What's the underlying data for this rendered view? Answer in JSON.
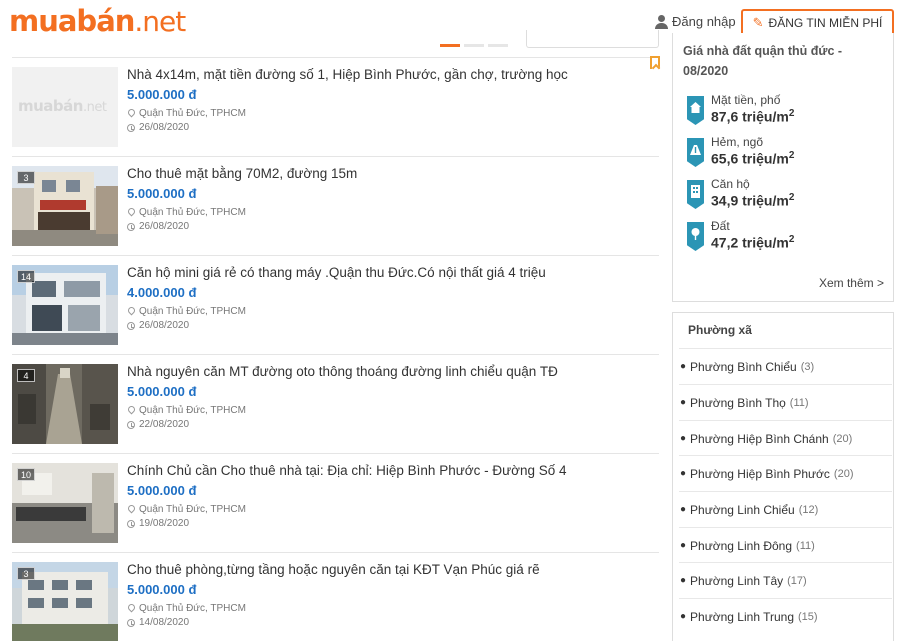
{
  "header": {
    "logo_main": "muabán",
    "logo_tld": ".net",
    "login_label": "Đăng nhập",
    "post_button_label": "ĐĂNG TIN MIỄN PHÍ"
  },
  "listings": [
    {
      "title": "Nhà 4x14m, mặt tiền đường số 1, Hiệp Bình Phước, gần chợ, trường học",
      "price": "5.000.000 đ",
      "location": "Quận Thủ Đức, TPHCM",
      "date": "26/08/2020",
      "photo_count": "",
      "placeholder_main": "muabán",
      "placeholder_tld": ".net"
    },
    {
      "title": "Cho thuê mặt bằng 70M2, đường 15m",
      "price": "5.000.000 đ",
      "location": "Quận Thủ Đức, TPHCM",
      "date": "26/08/2020",
      "photo_count": "3"
    },
    {
      "title": "Căn hộ mini giá rẻ có thang máy .Quận thu Đức.Có nội thất giá 4 triệu",
      "price": "4.000.000 đ",
      "location": "Quận Thủ Đức, TPHCM",
      "date": "26/08/2020",
      "photo_count": "14"
    },
    {
      "title": "Nhà nguyên căn MT đường oto thông thoáng đường linh chiểu quận TĐ",
      "price": "5.000.000 đ",
      "location": "Quận Thủ Đức, TPHCM",
      "date": "22/08/2020",
      "photo_count": "4"
    },
    {
      "title": "Chính Chủ cần Cho thuê nhà tại: Địa chỉ: Hiệp Bình Phước - Đường Số 4",
      "price": "5.000.000 đ",
      "location": "Quận Thủ Đức, TPHCM",
      "date": "19/08/2020",
      "photo_count": "10"
    },
    {
      "title": "Cho thuê phòng,từng tầng hoặc nguyên căn tại KĐT Vạn Phúc giá rẽ",
      "price": "5.000.000 đ",
      "location": "Quận Thủ Đức, TPHCM",
      "date": "14/08/2020",
      "photo_count": "3"
    }
  ],
  "price_panel": {
    "title": "Giá nhà đất quận thủ đức - 08/2020",
    "rows": [
      {
        "label": "Mặt tiền, phố",
        "value": "87,6 triệu/m",
        "sup": "2",
        "icon": "house-icon"
      },
      {
        "label": "Hẻm, ngõ",
        "value": "65,6 triệu/m",
        "sup": "2",
        "icon": "alley-icon"
      },
      {
        "label": "Căn hộ",
        "value": "34,9 triệu/m",
        "sup": "2",
        "icon": "apartment-icon"
      },
      {
        "label": "Đất",
        "value": "47,2 triệu/m",
        "sup": "2",
        "icon": "land-icon"
      }
    ],
    "more_label": "Xem thêm >"
  },
  "ward_panel": {
    "title": "Phường xã",
    "items": [
      {
        "name": "Phường Bình Chiểu",
        "count": "(3)"
      },
      {
        "name": "Phường Bình Thọ",
        "count": "(11)"
      },
      {
        "name": "Phường Hiệp Bình Chánh",
        "count": "(20)"
      },
      {
        "name": "Phường Hiệp Bình Phước",
        "count": "(20)"
      },
      {
        "name": "Phường Linh Chiểu",
        "count": "(12)"
      },
      {
        "name": "Phường Linh Đông",
        "count": "(11)"
      },
      {
        "name": "Phường Linh Tây",
        "count": "(17)"
      },
      {
        "name": "Phường Linh Trung",
        "count": "(15)"
      }
    ]
  },
  "colors": {
    "brand_orange": "#f36f21",
    "price_blue": "#1e6fc4",
    "icon_teal": "#2b95b5"
  }
}
